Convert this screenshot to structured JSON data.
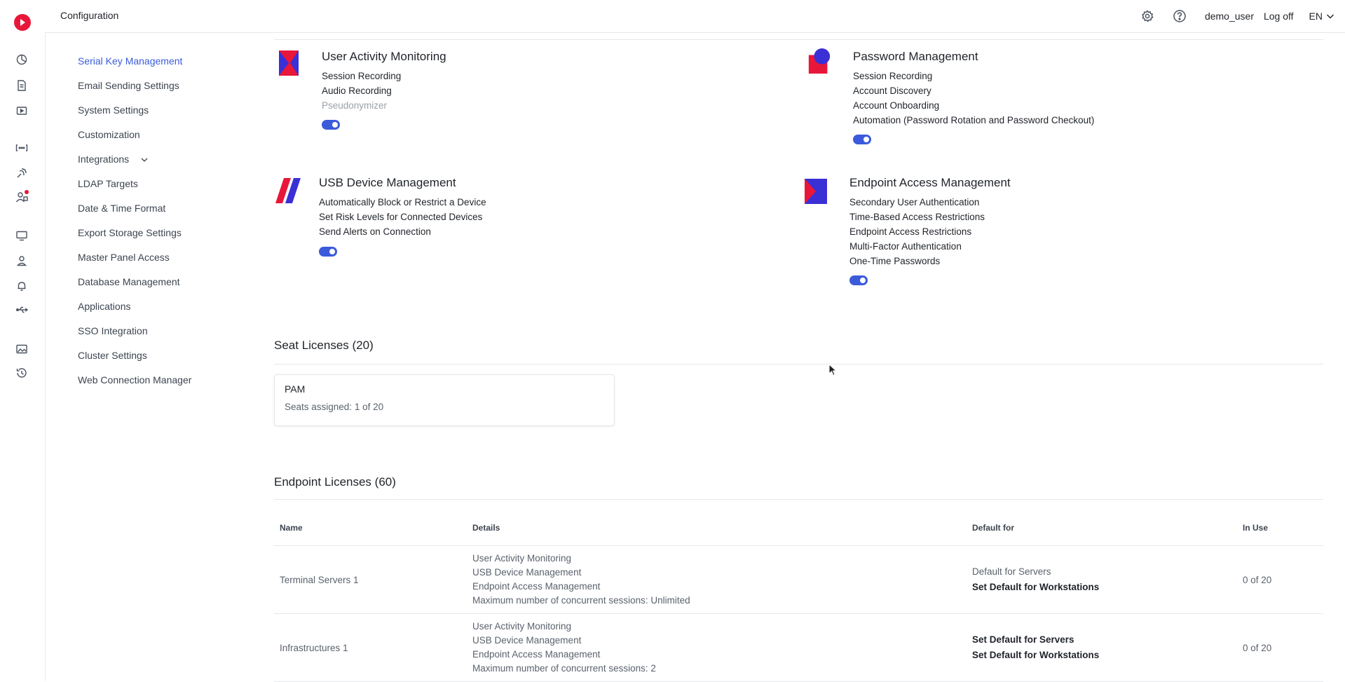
{
  "header": {
    "title": "Configuration",
    "user": "demo_user",
    "logoff": "Log off",
    "lang": "EN"
  },
  "settings_nav": {
    "items": [
      {
        "label": "Serial Key Management",
        "active": true
      },
      {
        "label": "Email Sending Settings"
      },
      {
        "label": "System Settings"
      },
      {
        "label": "Customization"
      },
      {
        "label": "Integrations",
        "expandable": true
      },
      {
        "label": "LDAP Targets"
      },
      {
        "label": "Date & Time Format"
      },
      {
        "label": "Export Storage Settings"
      },
      {
        "label": "Master Panel Access"
      },
      {
        "label": "Database Management"
      },
      {
        "label": "Applications"
      },
      {
        "label": "SSO Integration"
      },
      {
        "label": "Cluster Settings"
      },
      {
        "label": "Web Connection Manager"
      }
    ]
  },
  "features": {
    "uam": {
      "name": "User Activity Monitoring",
      "items": [
        "Session Recording",
        "Audio Recording",
        "Pseudonymizer"
      ],
      "enabled": true
    },
    "pam": {
      "name": "Password Management",
      "items": [
        "Session Recording",
        "Account Discovery",
        "Account Onboarding",
        "Automation (Password Rotation and Password Checkout)"
      ],
      "enabled": true
    },
    "usb": {
      "name": "USB Device Management",
      "items": [
        "Automatically Block or Restrict a Device",
        "Set Risk Levels for Connected Devices",
        "Send Alerts on Connection"
      ],
      "enabled": true
    },
    "eam": {
      "name": "Endpoint Access Management",
      "items": [
        "Secondary User Authentication",
        "Time-Based Access Restrictions",
        "Endpoint Access Restrictions",
        "Multi-Factor Authentication",
        "One-Time Passwords"
      ],
      "enabled": true
    }
  },
  "seat_licenses": {
    "title": "Seat Licenses (20)",
    "card": {
      "name": "PAM",
      "seats": "Seats assigned: 1 of 20"
    }
  },
  "endpoint_licenses": {
    "title": "Endpoint Licenses (60)",
    "columns": {
      "name": "Name",
      "details": "Details",
      "default_for": "Default for",
      "in_use": "In Use"
    },
    "rows": [
      {
        "name": "Terminal Servers 1",
        "details": [
          "User Activity Monitoring",
          "USB Device Management",
          "Endpoint Access Management",
          "Maximum number of concurrent sessions: Unlimited"
        ],
        "default_1": "Default for Servers",
        "default_2": "Set Default for Workstations",
        "in_use": "0 of 20"
      },
      {
        "name": "Infrastructures 1",
        "details": [
          "User Activity Monitoring",
          "USB Device Management",
          "Endpoint Access Management",
          "Maximum number of concurrent sessions: 2"
        ],
        "default_1": "Set Default for Servers",
        "default_2": "Set Default for Workstations",
        "in_use": "0 of 20"
      }
    ]
  },
  "colors": {
    "accent": "#3b5bdb",
    "brand": "#e8173a"
  },
  "rail_icons": [
    "dashboard-icon",
    "document-icon",
    "play-icon",
    "network-icon",
    "satellite-icon",
    "user-alert-icon",
    "monitor-icon",
    "user-icon",
    "bell-icon",
    "usb-icon",
    "image-icon",
    "history-icon"
  ]
}
